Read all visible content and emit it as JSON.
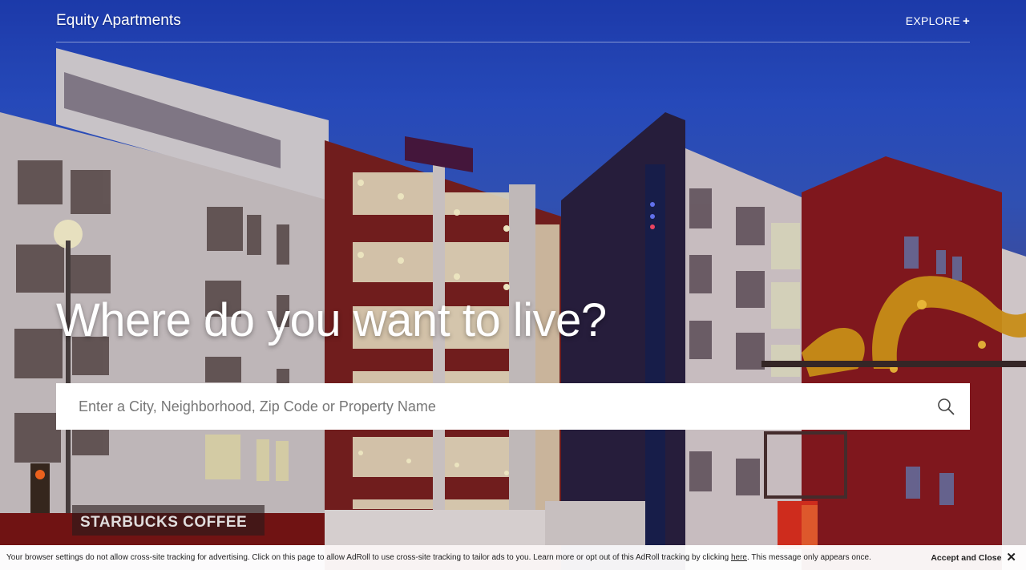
{
  "header": {
    "brand": "Equity Apartments",
    "explore_label": "EXPLORE",
    "explore_icon": "plus-icon"
  },
  "hero": {
    "headline": "Where do you want to live?",
    "storefront_sign": "STARBUCKS COFFEE"
  },
  "search": {
    "placeholder": "Enter a City, Neighborhood, Zip Code or Property Name",
    "value": "",
    "icon": "search-icon"
  },
  "cookie_banner": {
    "text_before": "Your browser settings do not allow cross-site tracking for advertising. Click on this page to allow AdRoll to use cross-site tracking to tailor ads to you. Learn more or opt out of this AdRoll tracking by clicking ",
    "link_text": "here",
    "text_after": ". This message only appears once.",
    "accept_label": "Accept and Close",
    "close_icon": "close-icon"
  }
}
